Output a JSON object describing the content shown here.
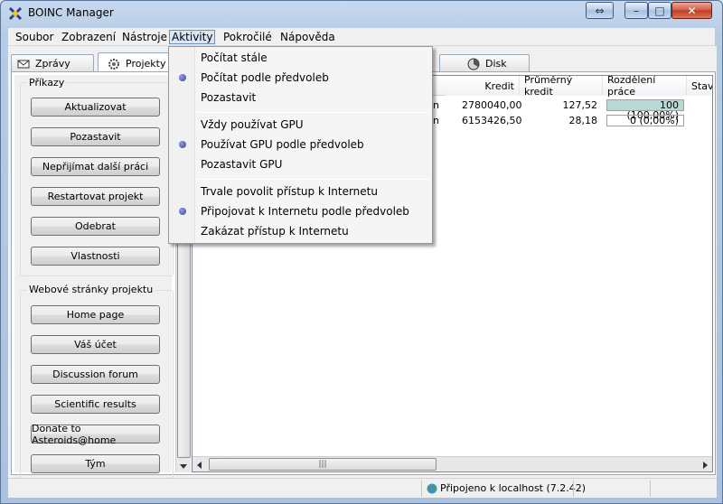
{
  "window": {
    "title": "BOINC Manager",
    "controls": {
      "restore": "⇔",
      "minimize": "–",
      "maximize": "□",
      "close": "✕"
    }
  },
  "menubar": {
    "items": [
      "Soubor",
      "Zobrazení",
      "Nástroje",
      "Aktivity",
      "Pokročilé",
      "Nápověda"
    ],
    "active": "Aktivity"
  },
  "tabs": [
    {
      "label": "Zprávy",
      "icon": "envelope-icon"
    },
    {
      "label": "Projekty",
      "icon": "gear-icon"
    },
    {
      "label": "Disk",
      "icon": "pie-icon"
    }
  ],
  "sidebar": {
    "commands_title": "Příkazy",
    "commands": [
      "Aktualizovat",
      "Pozastavit",
      "Nepřijímat další práci",
      "Restartovat projekt",
      "Odebrat",
      "Vlastnosti"
    ],
    "web_title": "Webové stránky projektu",
    "web_links": [
      "Home page",
      "Váš účet",
      "Discussion forum",
      "Scientific results",
      "Donate to Asteroids@home",
      "Tým"
    ]
  },
  "table": {
    "columns": [
      "Kredit",
      "Průměrný kredit",
      "Rozdělení práce",
      "Stav"
    ],
    "rows": [
      {
        "prefix": "n",
        "credit": "2780040,00",
        "avg": "127,52",
        "share": "100 (100,00%)",
        "share_fraction": 1.0
      },
      {
        "prefix": "n",
        "credit": "6153426,50",
        "avg": "28,18",
        "share": "0 (0,00%)",
        "share_fraction": 0.0
      }
    ]
  },
  "status": {
    "text": "Připojeno k localhost (7.2.42)"
  },
  "dropdown": {
    "items": [
      {
        "label": "Počítat stále",
        "selected": false
      },
      {
        "label": "Počítat podle předvoleb",
        "selected": true
      },
      {
        "label": "Pozastavit",
        "selected": false
      },
      {
        "label": "Vždy používat GPU",
        "selected": false
      },
      {
        "label": "Používat GPU podle předvoleb",
        "selected": true
      },
      {
        "label": "Pozastavit GPU",
        "selected": false
      },
      {
        "label": "Trvale povolit přístup k Internetu",
        "selected": false
      },
      {
        "label": "Připojovat k Internetu podle předvoleb",
        "selected": true
      },
      {
        "label": "Zakázat přístup k Internetu",
        "selected": false
      }
    ]
  },
  "colors": {
    "share_fill": "#b7d9d3",
    "radio": "#3a3f9c"
  }
}
